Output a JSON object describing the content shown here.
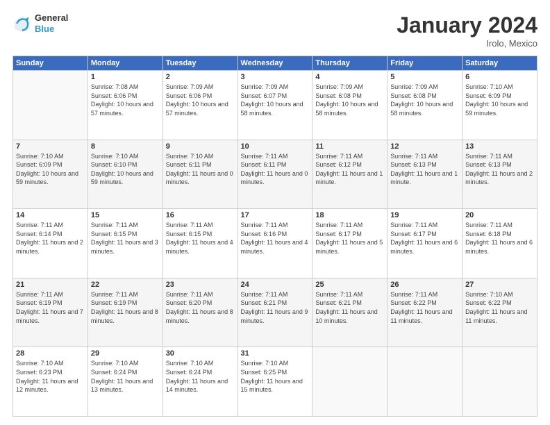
{
  "header": {
    "logo_line1": "General",
    "logo_line2": "Blue",
    "month_title": "January 2024",
    "subtitle": "Irolo, Mexico"
  },
  "weekdays": [
    "Sunday",
    "Monday",
    "Tuesday",
    "Wednesday",
    "Thursday",
    "Friday",
    "Saturday"
  ],
  "weeks": [
    [
      {
        "day": null
      },
      {
        "day": "1",
        "sunrise": "7:08 AM",
        "sunset": "6:06 PM",
        "daylight": "10 hours and 57 minutes."
      },
      {
        "day": "2",
        "sunrise": "7:09 AM",
        "sunset": "6:06 PM",
        "daylight": "10 hours and 57 minutes."
      },
      {
        "day": "3",
        "sunrise": "7:09 AM",
        "sunset": "6:07 PM",
        "daylight": "10 hours and 58 minutes."
      },
      {
        "day": "4",
        "sunrise": "7:09 AM",
        "sunset": "6:08 PM",
        "daylight": "10 hours and 58 minutes."
      },
      {
        "day": "5",
        "sunrise": "7:09 AM",
        "sunset": "6:08 PM",
        "daylight": "10 hours and 58 minutes."
      },
      {
        "day": "6",
        "sunrise": "7:10 AM",
        "sunset": "6:09 PM",
        "daylight": "10 hours and 59 minutes."
      }
    ],
    [
      {
        "day": "7",
        "sunrise": "7:10 AM",
        "sunset": "6:09 PM",
        "daylight": "10 hours and 59 minutes."
      },
      {
        "day": "8",
        "sunrise": "7:10 AM",
        "sunset": "6:10 PM",
        "daylight": "10 hours and 59 minutes."
      },
      {
        "day": "9",
        "sunrise": "7:10 AM",
        "sunset": "6:11 PM",
        "daylight": "11 hours and 0 minutes."
      },
      {
        "day": "10",
        "sunrise": "7:11 AM",
        "sunset": "6:11 PM",
        "daylight": "11 hours and 0 minutes."
      },
      {
        "day": "11",
        "sunrise": "7:11 AM",
        "sunset": "6:12 PM",
        "daylight": "11 hours and 1 minute."
      },
      {
        "day": "12",
        "sunrise": "7:11 AM",
        "sunset": "6:13 PM",
        "daylight": "11 hours and 1 minute."
      },
      {
        "day": "13",
        "sunrise": "7:11 AM",
        "sunset": "6:13 PM",
        "daylight": "11 hours and 2 minutes."
      }
    ],
    [
      {
        "day": "14",
        "sunrise": "7:11 AM",
        "sunset": "6:14 PM",
        "daylight": "11 hours and 2 minutes."
      },
      {
        "day": "15",
        "sunrise": "7:11 AM",
        "sunset": "6:15 PM",
        "daylight": "11 hours and 3 minutes."
      },
      {
        "day": "16",
        "sunrise": "7:11 AM",
        "sunset": "6:15 PM",
        "daylight": "11 hours and 4 minutes."
      },
      {
        "day": "17",
        "sunrise": "7:11 AM",
        "sunset": "6:16 PM",
        "daylight": "11 hours and 4 minutes."
      },
      {
        "day": "18",
        "sunrise": "7:11 AM",
        "sunset": "6:17 PM",
        "daylight": "11 hours and 5 minutes."
      },
      {
        "day": "19",
        "sunrise": "7:11 AM",
        "sunset": "6:17 PM",
        "daylight": "11 hours and 6 minutes."
      },
      {
        "day": "20",
        "sunrise": "7:11 AM",
        "sunset": "6:18 PM",
        "daylight": "11 hours and 6 minutes."
      }
    ],
    [
      {
        "day": "21",
        "sunrise": "7:11 AM",
        "sunset": "6:19 PM",
        "daylight": "11 hours and 7 minutes."
      },
      {
        "day": "22",
        "sunrise": "7:11 AM",
        "sunset": "6:19 PM",
        "daylight": "11 hours and 8 minutes."
      },
      {
        "day": "23",
        "sunrise": "7:11 AM",
        "sunset": "6:20 PM",
        "daylight": "11 hours and 8 minutes."
      },
      {
        "day": "24",
        "sunrise": "7:11 AM",
        "sunset": "6:21 PM",
        "daylight": "11 hours and 9 minutes."
      },
      {
        "day": "25",
        "sunrise": "7:11 AM",
        "sunset": "6:21 PM",
        "daylight": "11 hours and 10 minutes."
      },
      {
        "day": "26",
        "sunrise": "7:11 AM",
        "sunset": "6:22 PM",
        "daylight": "11 hours and 11 minutes."
      },
      {
        "day": "27",
        "sunrise": "7:10 AM",
        "sunset": "6:22 PM",
        "daylight": "11 hours and 11 minutes."
      }
    ],
    [
      {
        "day": "28",
        "sunrise": "7:10 AM",
        "sunset": "6:23 PM",
        "daylight": "11 hours and 12 minutes."
      },
      {
        "day": "29",
        "sunrise": "7:10 AM",
        "sunset": "6:24 PM",
        "daylight": "11 hours and 13 minutes."
      },
      {
        "day": "30",
        "sunrise": "7:10 AM",
        "sunset": "6:24 PM",
        "daylight": "11 hours and 14 minutes."
      },
      {
        "day": "31",
        "sunrise": "7:10 AM",
        "sunset": "6:25 PM",
        "daylight": "11 hours and 15 minutes."
      },
      {
        "day": null
      },
      {
        "day": null
      },
      {
        "day": null
      }
    ]
  ]
}
